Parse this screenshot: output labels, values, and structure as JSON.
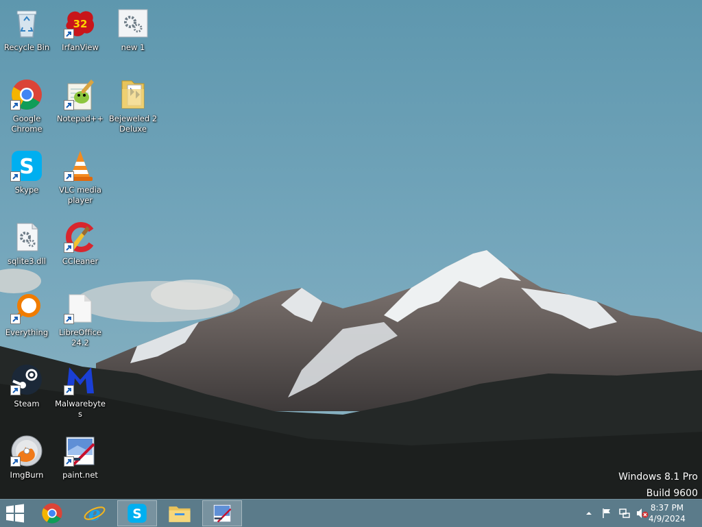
{
  "desktop": {
    "icons": [
      {
        "label": "Recycle Bin",
        "icon": "recycle-bin-icon",
        "shortcut": false
      },
      {
        "label": "IrfanView",
        "icon": "irfanview-icon",
        "shortcut": true
      },
      {
        "label": "new 1",
        "icon": "settings-file-icon",
        "shortcut": false
      },
      {
        "label": "Google Chrome",
        "icon": "chrome-icon",
        "shortcut": true
      },
      {
        "label": "Notepad++",
        "icon": "notepadpp-icon",
        "shortcut": true
      },
      {
        "label": "Bejeweled 2 Deluxe",
        "icon": "folder-icon",
        "shortcut": false
      },
      {
        "label": "Skype",
        "icon": "skype-icon",
        "shortcut": true
      },
      {
        "label": "VLC media player",
        "icon": "vlc-icon",
        "shortcut": true
      },
      {
        "label": "sqlite3.dll",
        "icon": "dll-file-icon",
        "shortcut": false
      },
      {
        "label": "CCleaner",
        "icon": "ccleaner-icon",
        "shortcut": true
      },
      {
        "label": "Everything",
        "icon": "everything-search-icon",
        "shortcut": true
      },
      {
        "label": "LibreOffice 24.2",
        "icon": "libreoffice-icon",
        "shortcut": true
      },
      {
        "label": "Steam",
        "icon": "steam-icon",
        "shortcut": true
      },
      {
        "label": "Malwarebytes",
        "icon": "malwarebytes-icon",
        "shortcut": true
      },
      {
        "label": "ImgBurn",
        "icon": "imgburn-icon",
        "shortcut": true
      },
      {
        "label": "paint.net",
        "icon": "paintnet-icon",
        "shortcut": true
      }
    ]
  },
  "watermark": {
    "line1": "Windows 8.1 Pro",
    "line2": "Build 9600"
  },
  "taskbar": {
    "buttons": [
      {
        "icon": "windows-start-icon",
        "active": false
      },
      {
        "icon": "chrome-icon",
        "active": false
      },
      {
        "icon": "internet-explorer-icon",
        "active": false
      },
      {
        "icon": "skype-icon",
        "active": true
      },
      {
        "icon": "file-explorer-icon",
        "active": false
      },
      {
        "icon": "paintnet-icon",
        "active": true
      }
    ],
    "tray": {
      "icons": [
        "show-hidden-icons-icon",
        "action-center-flag-icon",
        "network-icon",
        "volume-muted-icon"
      ]
    },
    "clock": {
      "time": "8:37 PM",
      "date": "4/9/2024"
    }
  },
  "colors": {
    "sky": "#6d9db3",
    "taskbar": "#5a7887",
    "skype": "#00aff0",
    "chrome_red": "#db4437",
    "chrome_yellow": "#f4b400",
    "chrome_green": "#0f9d58",
    "chrome_blue": "#4285f4"
  }
}
